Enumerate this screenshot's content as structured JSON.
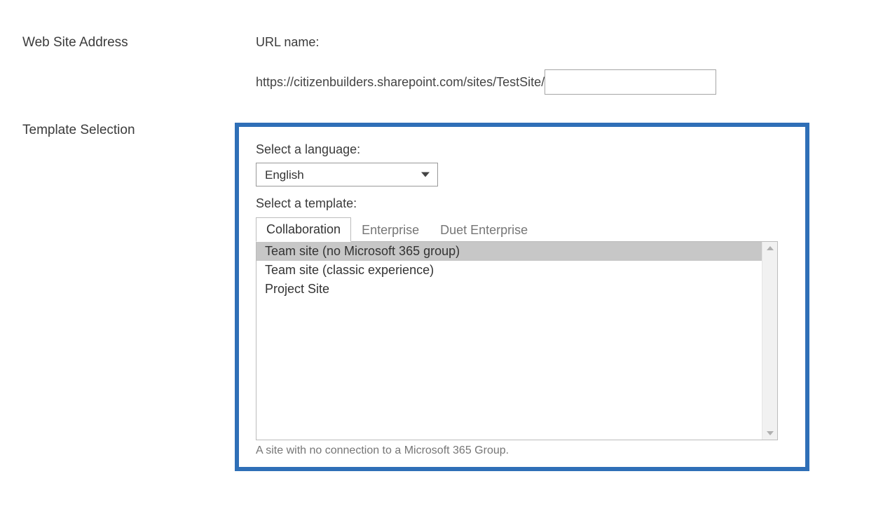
{
  "sections": {
    "address": {
      "heading": "Web Site Address",
      "url_label": "URL name:",
      "url_prefix": "https://citizenbuilders.sharepoint.com/sites/TestSite/",
      "url_value": ""
    },
    "template": {
      "heading": "Template Selection",
      "language_label": "Select a language:",
      "language_value": "English",
      "template_label": "Select a template:",
      "tabs": [
        {
          "label": "Collaboration"
        },
        {
          "label": "Enterprise"
        },
        {
          "label": "Duet Enterprise"
        }
      ],
      "items": [
        {
          "label": "Team site (no Microsoft 365 group)"
        },
        {
          "label": "Team site (classic experience)"
        },
        {
          "label": "Project Site"
        }
      ],
      "description": "A site with no connection to a Microsoft 365 Group."
    }
  }
}
